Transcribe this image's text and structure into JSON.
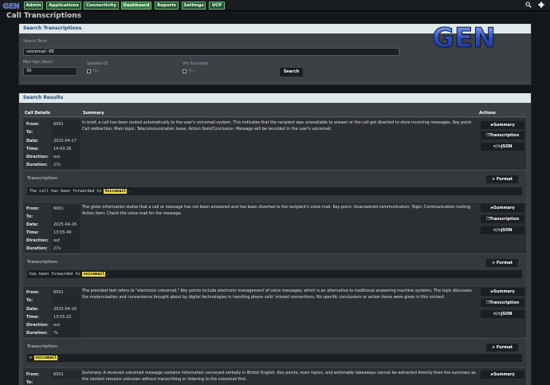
{
  "nav": {
    "items": [
      {
        "label": "Admin"
      },
      {
        "label": "Applications"
      },
      {
        "label": "Connectivity"
      },
      {
        "label": "Dashboard"
      },
      {
        "label": "Reports"
      },
      {
        "label": "Settings"
      },
      {
        "label": "UCP"
      }
    ],
    "search_icon": "search-icon",
    "gear_icon": "gear-icon"
  },
  "page": {
    "title": "Call Transcriptions"
  },
  "search": {
    "panel_title": "Search Transcriptions",
    "term_label": "Search Term",
    "term_value": "voicemail -EE",
    "maxage_label": "Max Age (days)",
    "maxage_value": "30",
    "speaker_label": "Speaker ID",
    "speaker_yes": "Yes",
    "vm_label": "Vm Summary",
    "vm_yes": "Yes",
    "button": "Search"
  },
  "logo": {
    "text": "GEN"
  },
  "results": {
    "panel_title": "Search Results",
    "columns": {
      "details": "Call Details",
      "summary": "Summary",
      "actions": "Actions"
    },
    "field_labels": {
      "from": "From:",
      "to": "To:",
      "date": "Date:",
      "time": "Time:",
      "direction": "Direction:",
      "duration": "Duration:"
    },
    "action_labels": {
      "summary": "Summary",
      "transcription": "Transcription",
      "json": "JSON",
      "format": "Format"
    },
    "transcription_label": "Transcription:",
    "records": [
      {
        "from": "6001",
        "to": "",
        "date": "2025-04-17",
        "time": "14:43:26",
        "direction": "out",
        "duration": "27s",
        "summary": "In brief, a call has been routed automatically to the user's voicemail system. This indicates that the recipient was unavailable to answer or the call got diverted to store incoming messages. Key point: Call redirection; Main topic: Telecommunication Issue; Action Item/Conclusion: Message will be recorded in the user's voicemail.",
        "trans_pre": "The call has been forwarded to ",
        "trans_hl": "Voicemail",
        "trans_post": "."
      },
      {
        "from": "6001",
        "to": "",
        "date": "2025-04-16",
        "time": "13:55:49",
        "direction": "out",
        "duration": "27s",
        "summary": "The given information states that a call or message has not been answered and has been diverted to the recipient's voice mail. Key point: Unanswered communication; Topic: Communication routing; Action item: Check the voice mail for the message.",
        "trans_pre": "has been forwarded to ",
        "trans_hl": "voicemail",
        "trans_post": "."
      },
      {
        "from": "6001",
        "to": "",
        "date": "2025-04-16",
        "time": "13:55:22",
        "direction": "out",
        "duration": "7s",
        "summary": "The provided text refers to \"electronic voicemail.\" Key points include electronic management of voice messages, which is an alternative to traditional answering machine systems. The topic discusses the modernization and convenience brought about by digital technologies in handling phone calls' missed connections. No specific conclusions or action items were given in this context.",
        "trans_pre": "e-",
        "trans_hl": "voicemail",
        "trans_post": "."
      },
      {
        "from": "6001",
        "summary": "Summary: A received voicemail message contains information conveyed verbally in British English. Key points, main topics, and actionable takeaways cannot be extracted directly from the summary as the content remains unknown without transcribing or listening to the voicemail first."
      }
    ]
  },
  "colors": {
    "accent": "#2f7d3e",
    "panel_head": "#dfe9ea",
    "highlight": "#f3e24a"
  }
}
